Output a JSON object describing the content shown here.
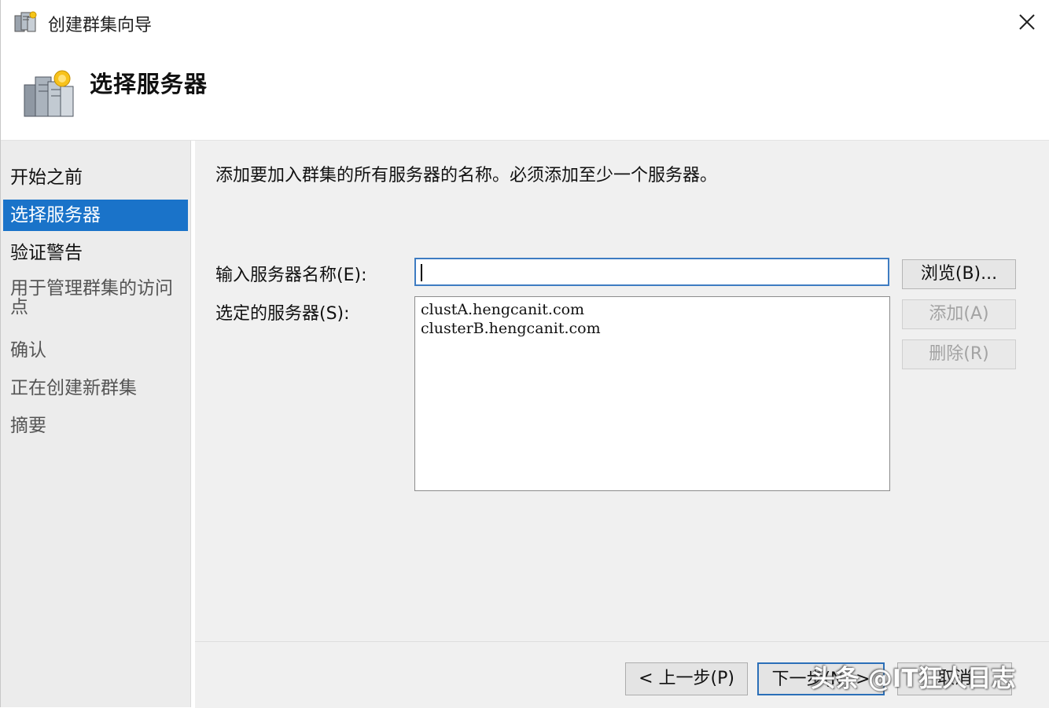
{
  "window": {
    "title": "创建群集向导",
    "app_icon": "cluster-wizard-icon",
    "close_icon": "close-icon"
  },
  "header": {
    "title": "选择服务器",
    "icon": "server-cluster-icon"
  },
  "nav": {
    "items": [
      {
        "label": "开始之前",
        "state": "done"
      },
      {
        "label": "选择服务器",
        "state": "selected"
      },
      {
        "label": "验证警告",
        "state": "done"
      },
      {
        "label": "用于管理群集的访问点",
        "state": "future"
      },
      {
        "label": "确认",
        "state": "future"
      },
      {
        "label": "正在创建新群集",
        "state": "future"
      },
      {
        "label": "摘要",
        "state": "future"
      }
    ]
  },
  "main": {
    "instruction": "添加要加入群集的所有服务器的名称。必须添加至少一个服务器。",
    "server_name_label": "输入服务器名称(E):",
    "server_name_value": "",
    "selected_label": "选定的服务器(S):",
    "selected_servers": [
      "clustA.hengcanit.com",
      "clusterB.hengcanit.com"
    ],
    "browse_label": "浏览(B)...",
    "add_label": "添加(A)",
    "remove_label": "删除(R)"
  },
  "footer": {
    "back_label": "< 上一步(P)",
    "next_label": "下一步(N) >",
    "cancel_label": "取消"
  },
  "watermark": "头条 @IT狂人日志",
  "colors": {
    "selection": "#1a73c9",
    "input_border": "#3e7cc2",
    "panel_bg": "#f0f0f0",
    "nav_bg": "#ececec"
  }
}
